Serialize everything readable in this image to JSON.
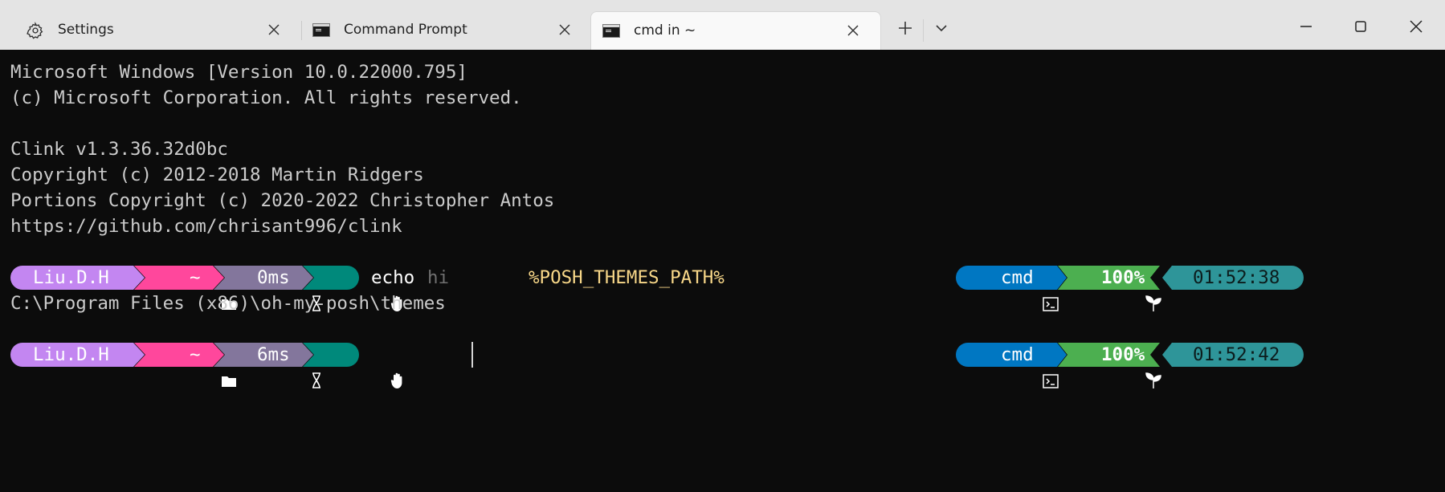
{
  "tabs": [
    {
      "label": "Settings",
      "icon": "gear-icon",
      "active": false
    },
    {
      "label": "Command Prompt",
      "icon": "command-prompt-icon",
      "active": false
    },
    {
      "label": "cmd in ~",
      "icon": "command-prompt-icon",
      "active": true
    }
  ],
  "terminal": {
    "lines": [
      "Microsoft Windows [Version 10.0.22000.795]",
      "(c) Microsoft Corporation. All rights reserved.",
      "",
      "Clink v1.3.36.32d0bc",
      "Copyright (c) 2012-2018 Martin Ridgers",
      "Portions Copyright (c) 2020-2022 Christopher Antos",
      "https://github.com/chrisant996/clink"
    ],
    "prompt1": {
      "user": "Liu.D.H",
      "path": "~",
      "duration": "0ms",
      "command": "echo",
      "command_suggestion": "hi",
      "command_arg": "%POSH_THEMES_PATH%",
      "shell": "cmd",
      "battery": "100%",
      "time": "01:52:38"
    },
    "output": "C:\\Program Files (x86)\\oh-my-posh\\themes",
    "prompt2": {
      "user": "Liu.D.H",
      "path": "~",
      "duration": "6ms",
      "shell": "cmd",
      "battery": "100%",
      "time": "01:52:42"
    }
  },
  "colors": {
    "user": "#c386f1",
    "path": "#ff479c",
    "duration": "#83769c",
    "status": "#00897b",
    "shell": "#0077c2",
    "battery": "#4caf50",
    "time": "#2e9599",
    "arg": "#f9d889",
    "suggestion": "#707070",
    "terminal_bg": "#0c0c0c",
    "terminal_fg": "#cccccc"
  }
}
